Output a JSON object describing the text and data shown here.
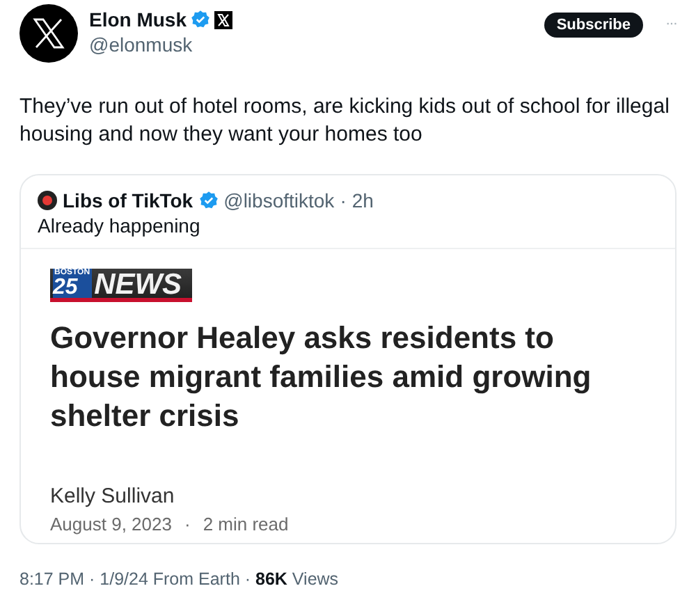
{
  "author": {
    "name": "Elon Musk",
    "verified": true,
    "handle": "@elonmusk"
  },
  "subscribe_button": "Subscribe",
  "more_menu": "···",
  "text": "They’ve run out of hotel rooms, are kicking kids out of school for illegal housing and now they want your homes too",
  "quote": {
    "author": "Libs of TikTok",
    "verified": true,
    "handle": "@libsoftiktok",
    "separator": "·",
    "time": "2h",
    "text": "Already happening",
    "article": {
      "logo": {
        "city": "BOSTON",
        "number": "25",
        "word": "NEWS"
      },
      "headline": "Governor Healey asks residents to house migrant families amid growing shelter crisis",
      "byline": "Kelly Sullivan",
      "date": "August 9, 2023",
      "separator": "·",
      "read_time": "2 min read"
    }
  },
  "footer": "8:17 PM · 1/9/24 From Earth · **86K** Views"
}
